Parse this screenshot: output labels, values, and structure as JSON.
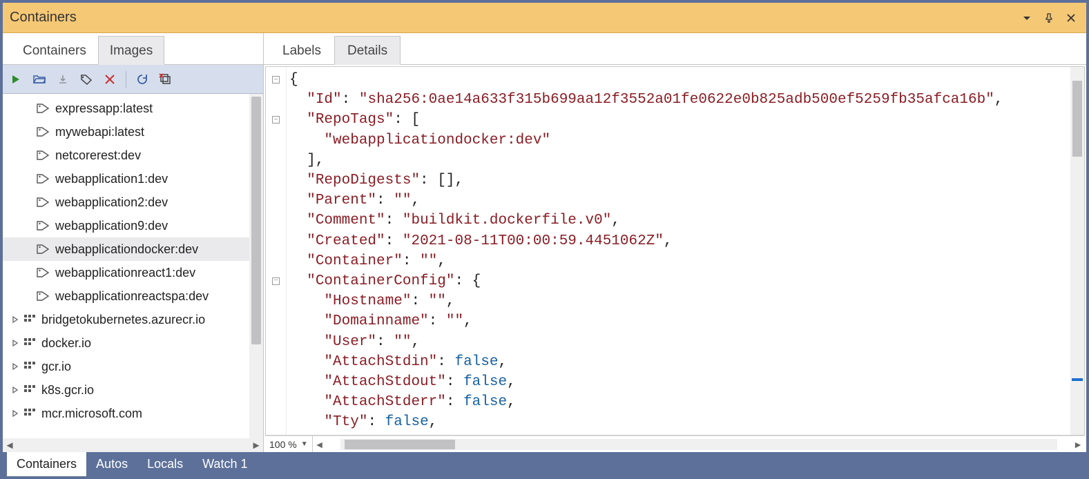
{
  "title": "Containers",
  "leftTabs": {
    "containers": "Containers",
    "images": "Images",
    "active": "images"
  },
  "rightTabs": {
    "labels": "Labels",
    "details": "Details",
    "active": "details"
  },
  "bottomTabs": [
    "Containers",
    "Autos",
    "Locals",
    "Watch 1"
  ],
  "bottomActive": 0,
  "zoom": "100 %",
  "images": [
    {
      "type": "tag",
      "label": "expressapp:latest"
    },
    {
      "type": "tag",
      "label": "mywebapi:latest"
    },
    {
      "type": "tag",
      "label": "netcorerest:dev"
    },
    {
      "type": "tag",
      "label": "webapplication1:dev"
    },
    {
      "type": "tag",
      "label": "webapplication2:dev"
    },
    {
      "type": "tag",
      "label": "webapplication9:dev"
    },
    {
      "type": "tag",
      "label": "webapplicationdocker:dev",
      "selected": true
    },
    {
      "type": "tag",
      "label": "webapplicationreact1:dev"
    },
    {
      "type": "tag",
      "label": "webapplicationreactspa:dev"
    },
    {
      "type": "reg",
      "label": "bridgetokubernetes.azurecr.io"
    },
    {
      "type": "reg",
      "label": "docker.io"
    },
    {
      "type": "reg",
      "label": "gcr.io"
    },
    {
      "type": "reg",
      "label": "k8s.gcr.io"
    },
    {
      "type": "reg",
      "label": "mcr.microsoft.com"
    }
  ],
  "json": {
    "Id": "sha256:0ae14a633f315b699aa12f3552a01fe0622e0b825adb500ef5259fb35afca16b",
    "RepoTags": [
      "webapplicationdocker:dev"
    ],
    "RepoDigests": [],
    "Parent": "",
    "Comment": "buildkit.dockerfile.v0",
    "Created": "2021-08-11T00:00:59.4451062Z",
    "Container": "",
    "ContainerConfig": {
      "Hostname": "",
      "Domainname": "",
      "User": "",
      "AttachStdin": false,
      "AttachStdout": false,
      "AttachStderr": false,
      "Tty": false
    }
  }
}
